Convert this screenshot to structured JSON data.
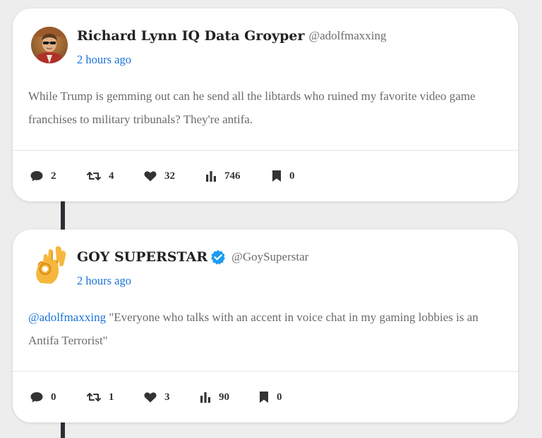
{
  "colors": {
    "background": "#ededed",
    "card": "#ffffff",
    "link": "#1a73d9",
    "body_text": "#6b6b6b",
    "connector": "#2b2f33",
    "verified": "#1d9bf0"
  },
  "posts": [
    {
      "display_name": "Richard Lynn IQ Data Groyper",
      "handle": "@adolfmaxxing",
      "verified": false,
      "avatar_icon": "profile-photo",
      "timestamp": "2 hours ago",
      "mention": "",
      "text": "While Trump is gemming out can he send all the libtards who ruined my favorite video game franchises to military tribunals? They're antifa.",
      "stats": {
        "replies": "2",
        "reposts": "4",
        "likes": "32",
        "views": "746",
        "bookmarks": "0"
      }
    },
    {
      "display_name": "GOY SUPERSTAR",
      "handle": "@GoySuperstar",
      "verified": true,
      "avatar_icon": "ok-hand-emoji",
      "timestamp": "2 hours ago",
      "mention": "@adolfmaxxing",
      "text": " \"Everyone who talks with an accent in voice chat in my gaming lobbies is an Antifa Terrorist\"",
      "stats": {
        "replies": "0",
        "reposts": "1",
        "likes": "3",
        "views": "90",
        "bookmarks": "0"
      }
    }
  ]
}
